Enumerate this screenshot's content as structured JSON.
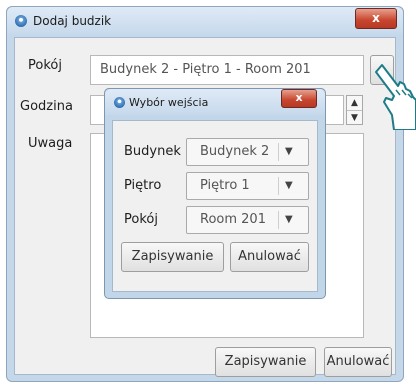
{
  "main_window": {
    "title": "Dodaj budzik",
    "close_label": "x",
    "room_label": "Pokój",
    "room_value": "Budynek 2 - Piętro 1 - Room 201",
    "browse_label": "...",
    "time_label": "Godzina",
    "note_label": "Uwaga",
    "save_label": "Zapisywanie",
    "cancel_label": "Anulować",
    "spin_up": "▲",
    "spin_down": "▼"
  },
  "dialog": {
    "title": "Wybór wejścia",
    "close_label": "x",
    "building_label": "Budynek",
    "building_value": "Budynek 2",
    "floor_label": "Piętro",
    "floor_value": "Piętro 1",
    "room_label": "Pokój",
    "room_value": "Room 201",
    "save_label": "Zapisywanie",
    "cancel_label": "Anulować",
    "dropdown_arrow": "▼"
  }
}
